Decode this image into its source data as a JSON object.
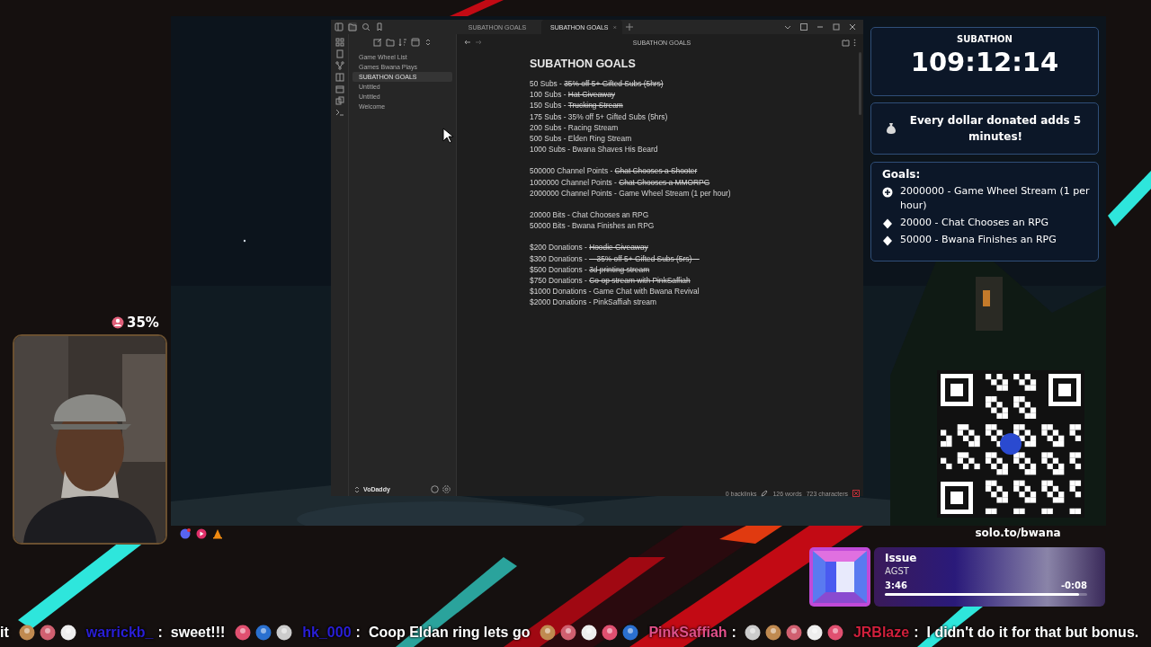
{
  "editor": {
    "tabs": [
      {
        "label": "SUBATHON GOALS",
        "selected": false
      },
      {
        "label": "SUBATHON GOALS",
        "selected": true
      }
    ],
    "files": [
      {
        "label": "Game Wheel List",
        "selected": false
      },
      {
        "label": "Games Bwana Plays",
        "selected": false
      },
      {
        "label": "SUBATHON GOALS",
        "selected": true
      },
      {
        "label": "Untitled",
        "selected": false
      },
      {
        "label": "Untitled",
        "selected": false
      },
      {
        "label": "Welcome",
        "selected": false
      }
    ],
    "vault": "VoDaddy",
    "header": "SUBATHON GOALS",
    "note": {
      "title": "SUBATHON GOALS",
      "groups": [
        [
          {
            "prefix": "50 Subs - ",
            "goal": "35% off 5+ Gifted Subs (5hrs)",
            "done": true
          },
          {
            "prefix": "100 Subs - ",
            "goal": "Hat Giveaway",
            "done": true
          },
          {
            "prefix": "150 Subs - ",
            "goal": "Trucking Stream",
            "done": true
          },
          {
            "prefix": "175 Subs - ",
            "goal": "35% off 5+ Gifted Subs (5hrs)",
            "done": false
          },
          {
            "prefix": "200 Subs - ",
            "goal": "Racing Stream",
            "done": false
          },
          {
            "prefix": "500 Subs - ",
            "goal": "Elden Ring Stream",
            "done": false
          },
          {
            "prefix": "1000 Subs - ",
            "goal": "Bwana Shaves His Beard",
            "done": false
          }
        ],
        [
          {
            "prefix": "500000 Channel Points - ",
            "goal": "Chat Chooses a Shooter",
            "done": true
          },
          {
            "prefix": "1000000 Channel Points - ",
            "goal": "Chat Chooses a MMORPG",
            "done": true
          },
          {
            "prefix": "2000000 Channel Points - ",
            "goal": "Game Wheel Stream (1 per hour)",
            "done": false
          }
        ],
        [
          {
            "prefix": "20000 Bits - ",
            "goal": "Chat Chooses an RPG",
            "done": false
          },
          {
            "prefix": "50000 Bits - ",
            "goal": "Bwana Finishes an RPG",
            "done": false
          }
        ],
        [
          {
            "prefix": "$200 Donations - ",
            "goal": "Hoodie Giveaway",
            "done": true
          },
          {
            "prefix": "$300 Donations - ",
            "goal": "—35% off 5+ Gifted Subs (5rs)—",
            "done": true
          },
          {
            "prefix": "$500 Donations - ",
            "goal": "3d printing stream",
            "done": true
          },
          {
            "prefix": "$750 Donations - ",
            "goal": "Co-op stream with PinkSaffiah",
            "done": true
          },
          {
            "prefix": "$1000 Donations - ",
            "goal": "Game Chat with Bwana Revival",
            "done": false
          },
          {
            "prefix": "$2000 Donations - ",
            "goal": "PinkSaffiah stream",
            "done": false
          }
        ]
      ]
    },
    "status": [
      "0 backlinks",
      "126 words",
      "723 characters"
    ]
  },
  "timer": {
    "title": "SUBATHON",
    "time": "109:12:14"
  },
  "donation_note": "Every dollar donated adds 5 minutes!",
  "goals": {
    "title": "Goals:",
    "items": [
      {
        "kind": "current",
        "text": "2000000 - Game Wheel Stream (1 per hour)"
      },
      {
        "kind": "next",
        "text": "20000 - Chat Chooses an RPG"
      },
      {
        "kind": "next",
        "text": "50000 - Bwana Finishes an RPG"
      }
    ]
  },
  "webcam": {
    "percent": "35%"
  },
  "qr": {
    "link": "solo.to/bwana"
  },
  "now_playing": {
    "title": "Issue",
    "artist": "AGST",
    "elapsed": "3:46",
    "remaining": "-0:08",
    "level": 0.96
  },
  "ticker": [
    {
      "kind": "text",
      "message": "it"
    },
    {
      "kind": "emote"
    },
    {
      "kind": "emote"
    },
    {
      "kind": "emote"
    },
    {
      "kind": "message",
      "user": "warrickb_",
      "color": "#2a1fd8",
      "separator": ":",
      "message": "sweet!!!"
    },
    {
      "kind": "emote"
    },
    {
      "kind": "emote"
    },
    {
      "kind": "emote"
    },
    {
      "kind": "message",
      "user": "hk_000",
      "color": "#2a1fd8",
      "separator": ":",
      "message": "Coop Eldan ring lets go"
    },
    {
      "kind": "emote"
    },
    {
      "kind": "emote"
    },
    {
      "kind": "emote"
    },
    {
      "kind": "emote"
    },
    {
      "kind": "emote"
    },
    {
      "kind": "message",
      "user": "PinkSaffiah",
      "color": "#e0508a",
      "separator": ":"
    },
    {
      "kind": "emote"
    },
    {
      "kind": "emote"
    },
    {
      "kind": "emote"
    },
    {
      "kind": "emote"
    },
    {
      "kind": "emote"
    },
    {
      "kind": "message",
      "user": "JRBlaze",
      "color": "#d0203c",
      "separator": ":",
      "message": "I didn't do it for that but bonus."
    }
  ]
}
